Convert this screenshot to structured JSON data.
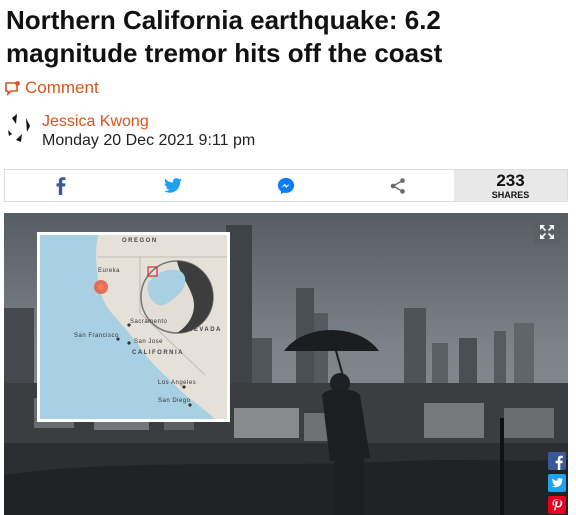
{
  "article": {
    "headline": "Northern California earthquake: 6.2 magnitude tremor hits off the coast",
    "comment_label": "Comment",
    "author": "Jessica Kwong",
    "date": "Monday 20 Dec 2021 9:11 pm"
  },
  "share_bar": {
    "buttons": [
      "facebook-icon",
      "twitter-icon",
      "messenger-icon",
      "share-icon"
    ],
    "count": "233",
    "count_label": "SHARES",
    "colors": {
      "facebook": "#3b5998",
      "twitter": "#1da1f2",
      "messenger": "#0a7cff",
      "share": "#6d6d6d"
    }
  },
  "hero_image": {
    "map_labels": {
      "oregon": "OREGON",
      "eureka": "Eureka",
      "sacramento": "Sacramento",
      "nevada": "NEVADA",
      "san_francisco": "San Francisco",
      "san_jose": "San Jose",
      "california": "CALIFORNIA",
      "los_angeles": "Los Angeles",
      "san_diego": "San Diego"
    },
    "social_rail": [
      "facebook-icon",
      "twitter-icon",
      "pinterest-icon"
    ],
    "accent": "#d9541e"
  }
}
